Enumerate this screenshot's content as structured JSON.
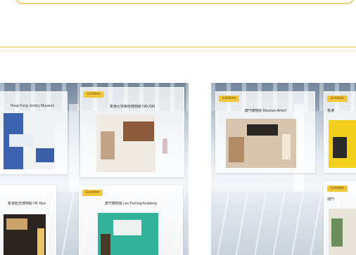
{
  "booths": {
    "left": [
      {
        "badge": "Exhibitor",
        "name": "Hong Kong Jockey Museum"
      },
      {
        "badge": "Exhibitor",
        "name": "香港大學美術博物館 HKUSM"
      },
      {
        "badge": "Exhibitor",
        "name": "香港歷史博物館 HK Mus"
      },
      {
        "badge": "Exhibitor",
        "name": "澳門博物館 Lao Pacheg Academy"
      }
    ],
    "right": [
      {
        "badge": "Exhibitor",
        "name": "澳門博物館 Museum Ameri"
      },
      {
        "badge": "Exhibitor",
        "name": "香港"
      },
      {
        "badge": "Exhibitor",
        "name": "澳門"
      }
    ]
  },
  "colors": {
    "accent": "#f2c63a",
    "border": "#e9cf7c"
  }
}
